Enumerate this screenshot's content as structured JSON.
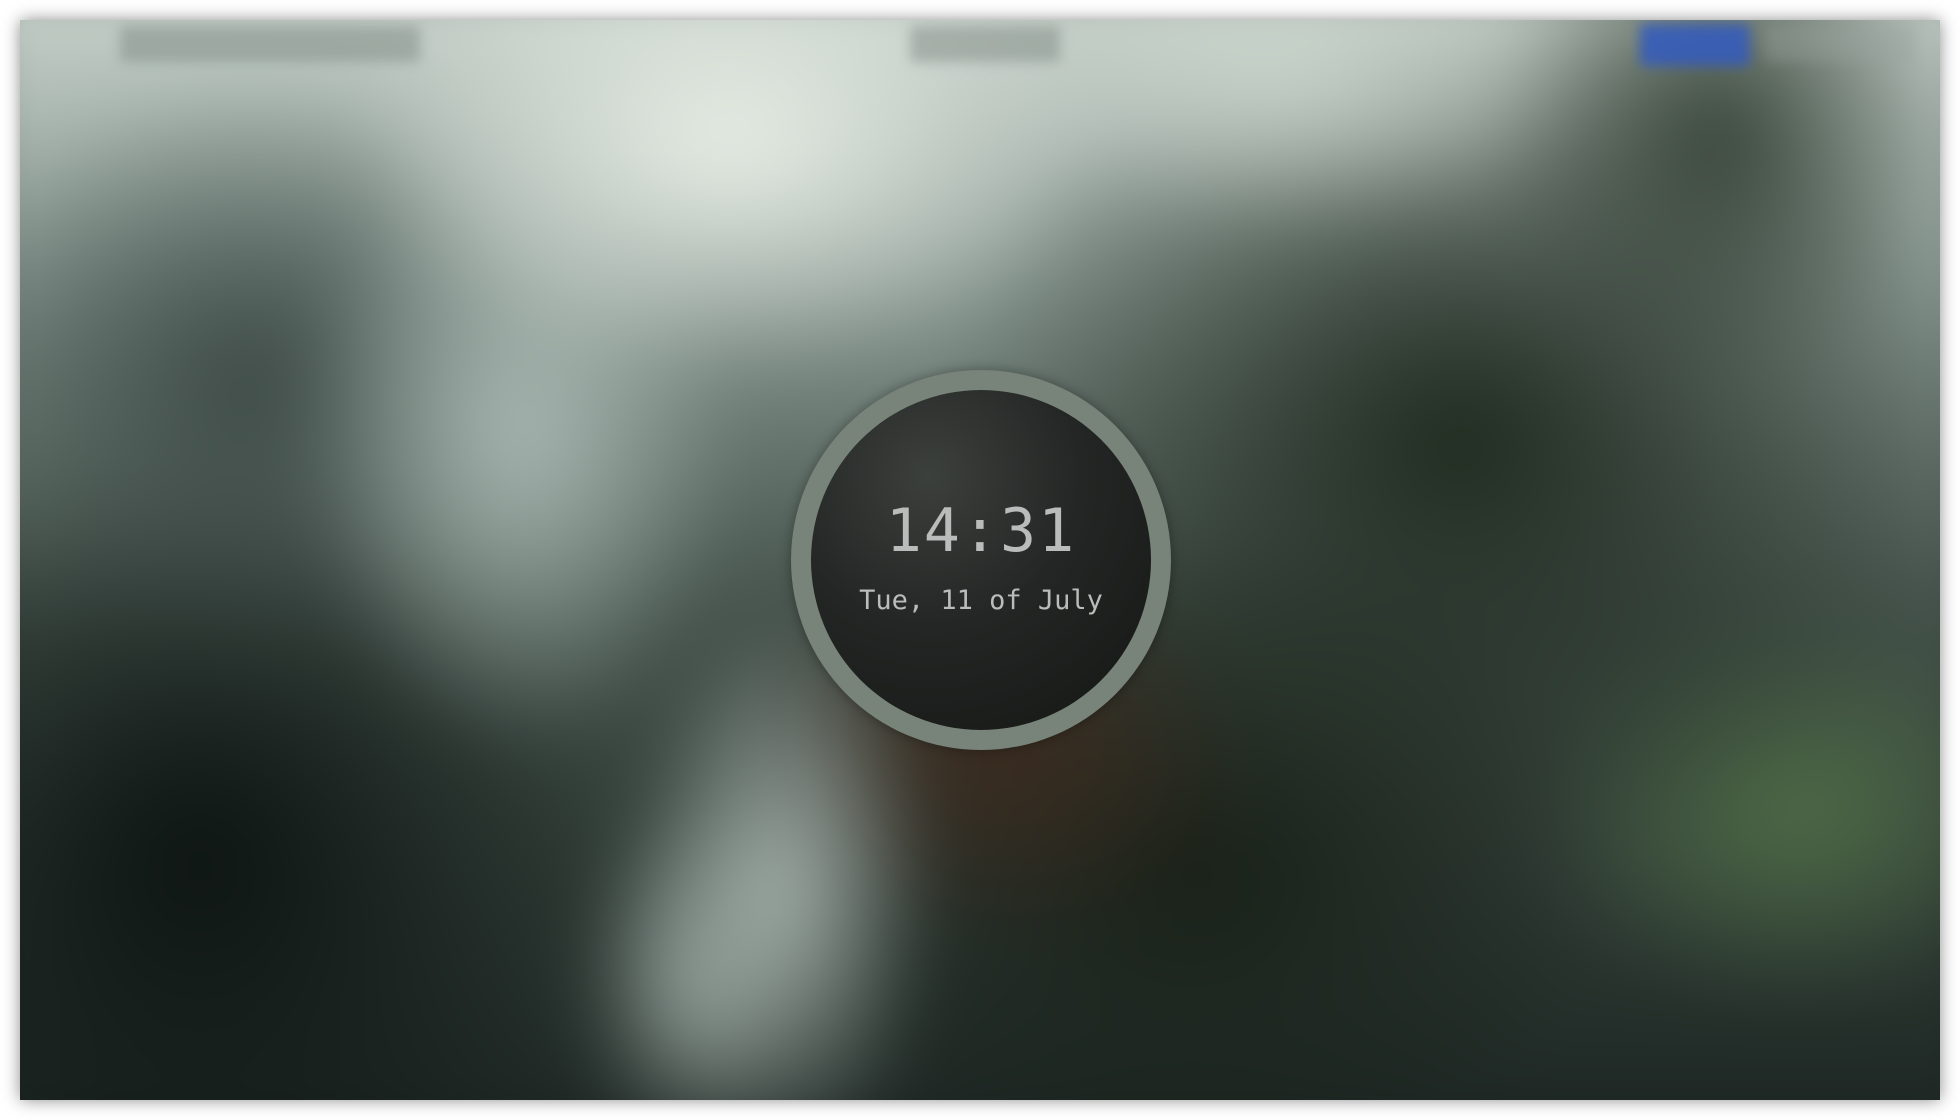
{
  "lockscreen": {
    "time": "14:31",
    "date": "Tue, 11 of July"
  },
  "colors": {
    "ring": "#78847a",
    "face": "#1d201e",
    "text": "#b9bcba",
    "bar_accent": "#325abe"
  }
}
